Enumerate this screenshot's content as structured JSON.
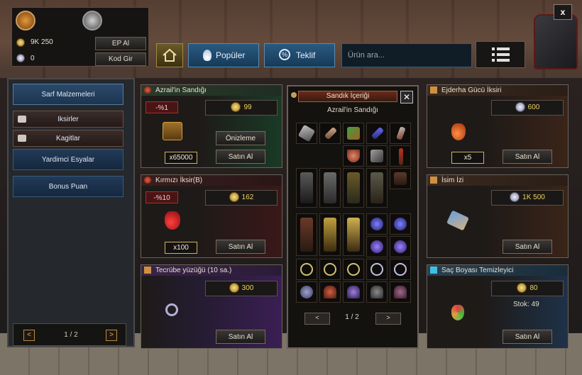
{
  "currency": {
    "gold_amount": "9K 250",
    "silver_amount": "0",
    "ep_button": "EP Al",
    "code_button": "Kod Gir"
  },
  "topbar": {
    "popular_tab": "Popüler",
    "offer_tab": "Teklif",
    "search_placeholder": "Ürün ara...",
    "close_label": "x"
  },
  "sidebar": {
    "items": [
      {
        "label": "Sarf Malzemeleri"
      },
      {
        "label": "Iksirler"
      },
      {
        "label": "Kagitlar"
      },
      {
        "label": "Yardimci Esyalar"
      },
      {
        "label": "Bonus Puan"
      }
    ],
    "pager": {
      "prev": "<",
      "page": "1 / 2",
      "next": ">"
    }
  },
  "products": [
    {
      "title": "Azrail'in Sandığı",
      "discount": "-%1",
      "price": "99",
      "quantity": "x65000",
      "preview": "Önizleme",
      "buy": "Satın Al"
    },
    {
      "title": "Kırmızı İksir(B)",
      "discount": "-%10",
      "price": "162",
      "quantity": "x100",
      "buy": "Satın Al"
    },
    {
      "title": "Tecrübe yüzüğü (10 sa.)",
      "price": "300",
      "buy": "Satın Al"
    },
    {
      "title": "Ejderha Gücü İksiri",
      "price": "600",
      "quantity": "x5",
      "buy": "Satın Al"
    },
    {
      "title": "İsim İzi",
      "price": "1K 500",
      "buy": "Satın Al"
    },
    {
      "title": "Saç Boyası Temizleyici",
      "price": "80",
      "stock": "Stok: 49",
      "buy": "Satın Al"
    }
  ],
  "chest_popup": {
    "title": "Sandık İçeriği",
    "close_label": "✕",
    "subtitle": "Azrail'in Sandığı",
    "pager": {
      "prev": "<",
      "page": "1 / 2",
      "next": ">"
    }
  },
  "colors": {
    "gold": "#f0d060",
    "accent_blue": "#2a5a80",
    "discount_red": "#a03030"
  }
}
